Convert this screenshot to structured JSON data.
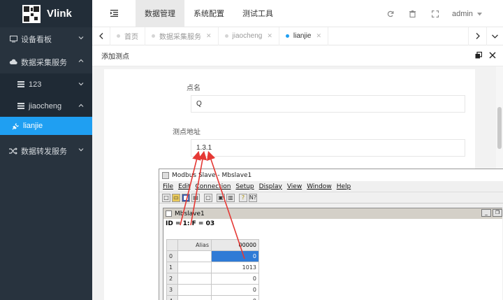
{
  "app": {
    "name": "Vlink"
  },
  "sidebar": {
    "items": [
      {
        "label": "设备看板",
        "icon": "monitor-icon"
      },
      {
        "label": "数据采集服务",
        "icon": "cloud-icon"
      },
      {
        "label": "123",
        "icon": "server-icon"
      },
      {
        "label": "jiaocheng",
        "icon": "server-icon"
      },
      {
        "label": "lianjie",
        "icon": "plug-icon"
      },
      {
        "label": "数据转发服务",
        "icon": "shuffle-icon"
      }
    ]
  },
  "header": {
    "tabs": [
      "数据管理",
      "系统配置",
      "测试工具"
    ],
    "user": "admin"
  },
  "tabstrip": {
    "tabs": [
      "首页",
      "数据采集服务",
      "jiaocheng",
      "lianjie"
    ]
  },
  "panel": {
    "title": "添加测点",
    "fields": [
      {
        "label": "点名",
        "value": "Q"
      },
      {
        "label": "测点地址",
        "value": "1.3.1"
      }
    ]
  },
  "modbus": {
    "title": "Modbus Slave - Mbslave1",
    "menu": [
      "File",
      "Edit",
      "Connection",
      "Setup",
      "Display",
      "View",
      "Window",
      "Help"
    ],
    "child_title": "Mbslave1",
    "id_line": "ID = 1: F = 03",
    "col_alias": "Alias",
    "col_value": "00000",
    "rows": [
      {
        "idx": "0",
        "value": "0"
      },
      {
        "idx": "1",
        "value": "1013"
      },
      {
        "idx": "2",
        "value": "0"
      },
      {
        "idx": "3",
        "value": "0"
      },
      {
        "idx": "4",
        "value": "0"
      }
    ]
  },
  "colors": {
    "sidebar_bg": "#28333e",
    "accent": "#1f9ff2",
    "arrow": "#e53935"
  }
}
